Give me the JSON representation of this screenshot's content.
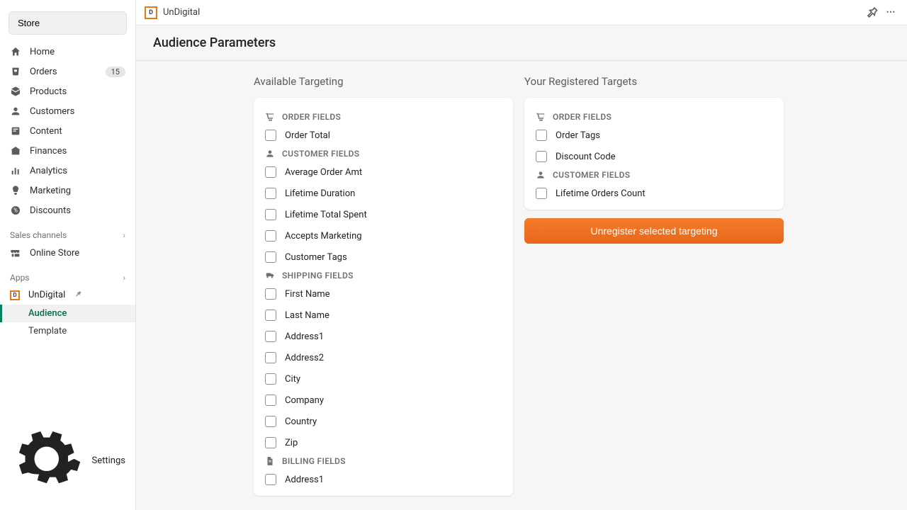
{
  "sidebar": {
    "store_btn": "Store",
    "nav": [
      {
        "id": "home",
        "label": "Home"
      },
      {
        "id": "orders",
        "label": "Orders",
        "badge": "15"
      },
      {
        "id": "products",
        "label": "Products"
      },
      {
        "id": "customers",
        "label": "Customers"
      },
      {
        "id": "content",
        "label": "Content"
      },
      {
        "id": "finances",
        "label": "Finances"
      },
      {
        "id": "analytics",
        "label": "Analytics"
      },
      {
        "id": "marketing",
        "label": "Marketing"
      },
      {
        "id": "discounts",
        "label": "Discounts"
      }
    ],
    "sales_channels_label": "Sales channels",
    "online_store_label": "Online Store",
    "apps_label": "Apps",
    "app_name": "UnDigital",
    "app_sub": [
      {
        "id": "audience",
        "label": "Audience",
        "active": true
      },
      {
        "id": "template",
        "label": "Template",
        "active": false
      }
    ],
    "settings_label": "Settings"
  },
  "topbar": {
    "app_name": "UnDigital"
  },
  "page": {
    "title": "Audience Parameters",
    "available": {
      "title": "Available Targeting",
      "groups": [
        {
          "id": "order",
          "label": "ORDER FIELDS",
          "icon": "cart",
          "fields": [
            "Order Total"
          ]
        },
        {
          "id": "customer",
          "label": "CUSTOMER FIELDS",
          "icon": "person",
          "fields": [
            "Average Order Amt",
            "Lifetime Duration",
            "Lifetime Total Spent",
            "Accepts Marketing",
            "Customer Tags"
          ]
        },
        {
          "id": "shipping",
          "label": "SHIPPING FIELDS",
          "icon": "truck",
          "fields": [
            "First Name",
            "Last Name",
            "Address1",
            "Address2",
            "City",
            "Company",
            "Country",
            "Zip"
          ]
        },
        {
          "id": "billing",
          "label": "BILLING FIELDS",
          "icon": "file",
          "fields": [
            "Address1"
          ]
        }
      ]
    },
    "registered": {
      "title": "Your Registered Targets",
      "groups": [
        {
          "id": "order",
          "label": "ORDER FIELDS",
          "icon": "cart",
          "fields": [
            "Order Tags",
            "Discount Code"
          ]
        },
        {
          "id": "customer",
          "label": "CUSTOMER FIELDS",
          "icon": "person",
          "fields": [
            "Lifetime Orders Count"
          ]
        }
      ],
      "action_label": "Unregister selected targeting"
    }
  }
}
